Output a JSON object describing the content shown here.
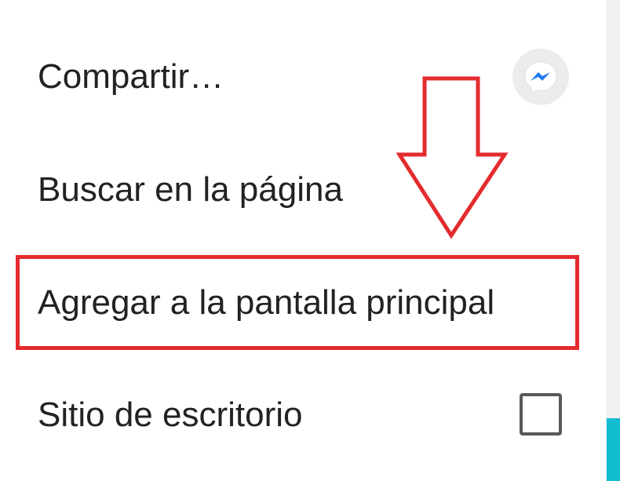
{
  "menu": {
    "items": [
      {
        "label": "Compartir…",
        "icon": "messenger-icon"
      },
      {
        "label": "Buscar en la página"
      },
      {
        "label": "Agregar a la pantalla principal",
        "highlighted": true
      },
      {
        "label": "Sitio de escritorio",
        "control": "checkbox",
        "checked": false
      }
    ]
  },
  "annotation": {
    "color": "#e32b2e",
    "arrow": "down-arrow-icon",
    "target": "Agregar a la pantalla principal"
  },
  "colors": {
    "messenger_blue": "#1f7bf2",
    "accent_teal": "#12bcd1",
    "text": "#222222"
  }
}
